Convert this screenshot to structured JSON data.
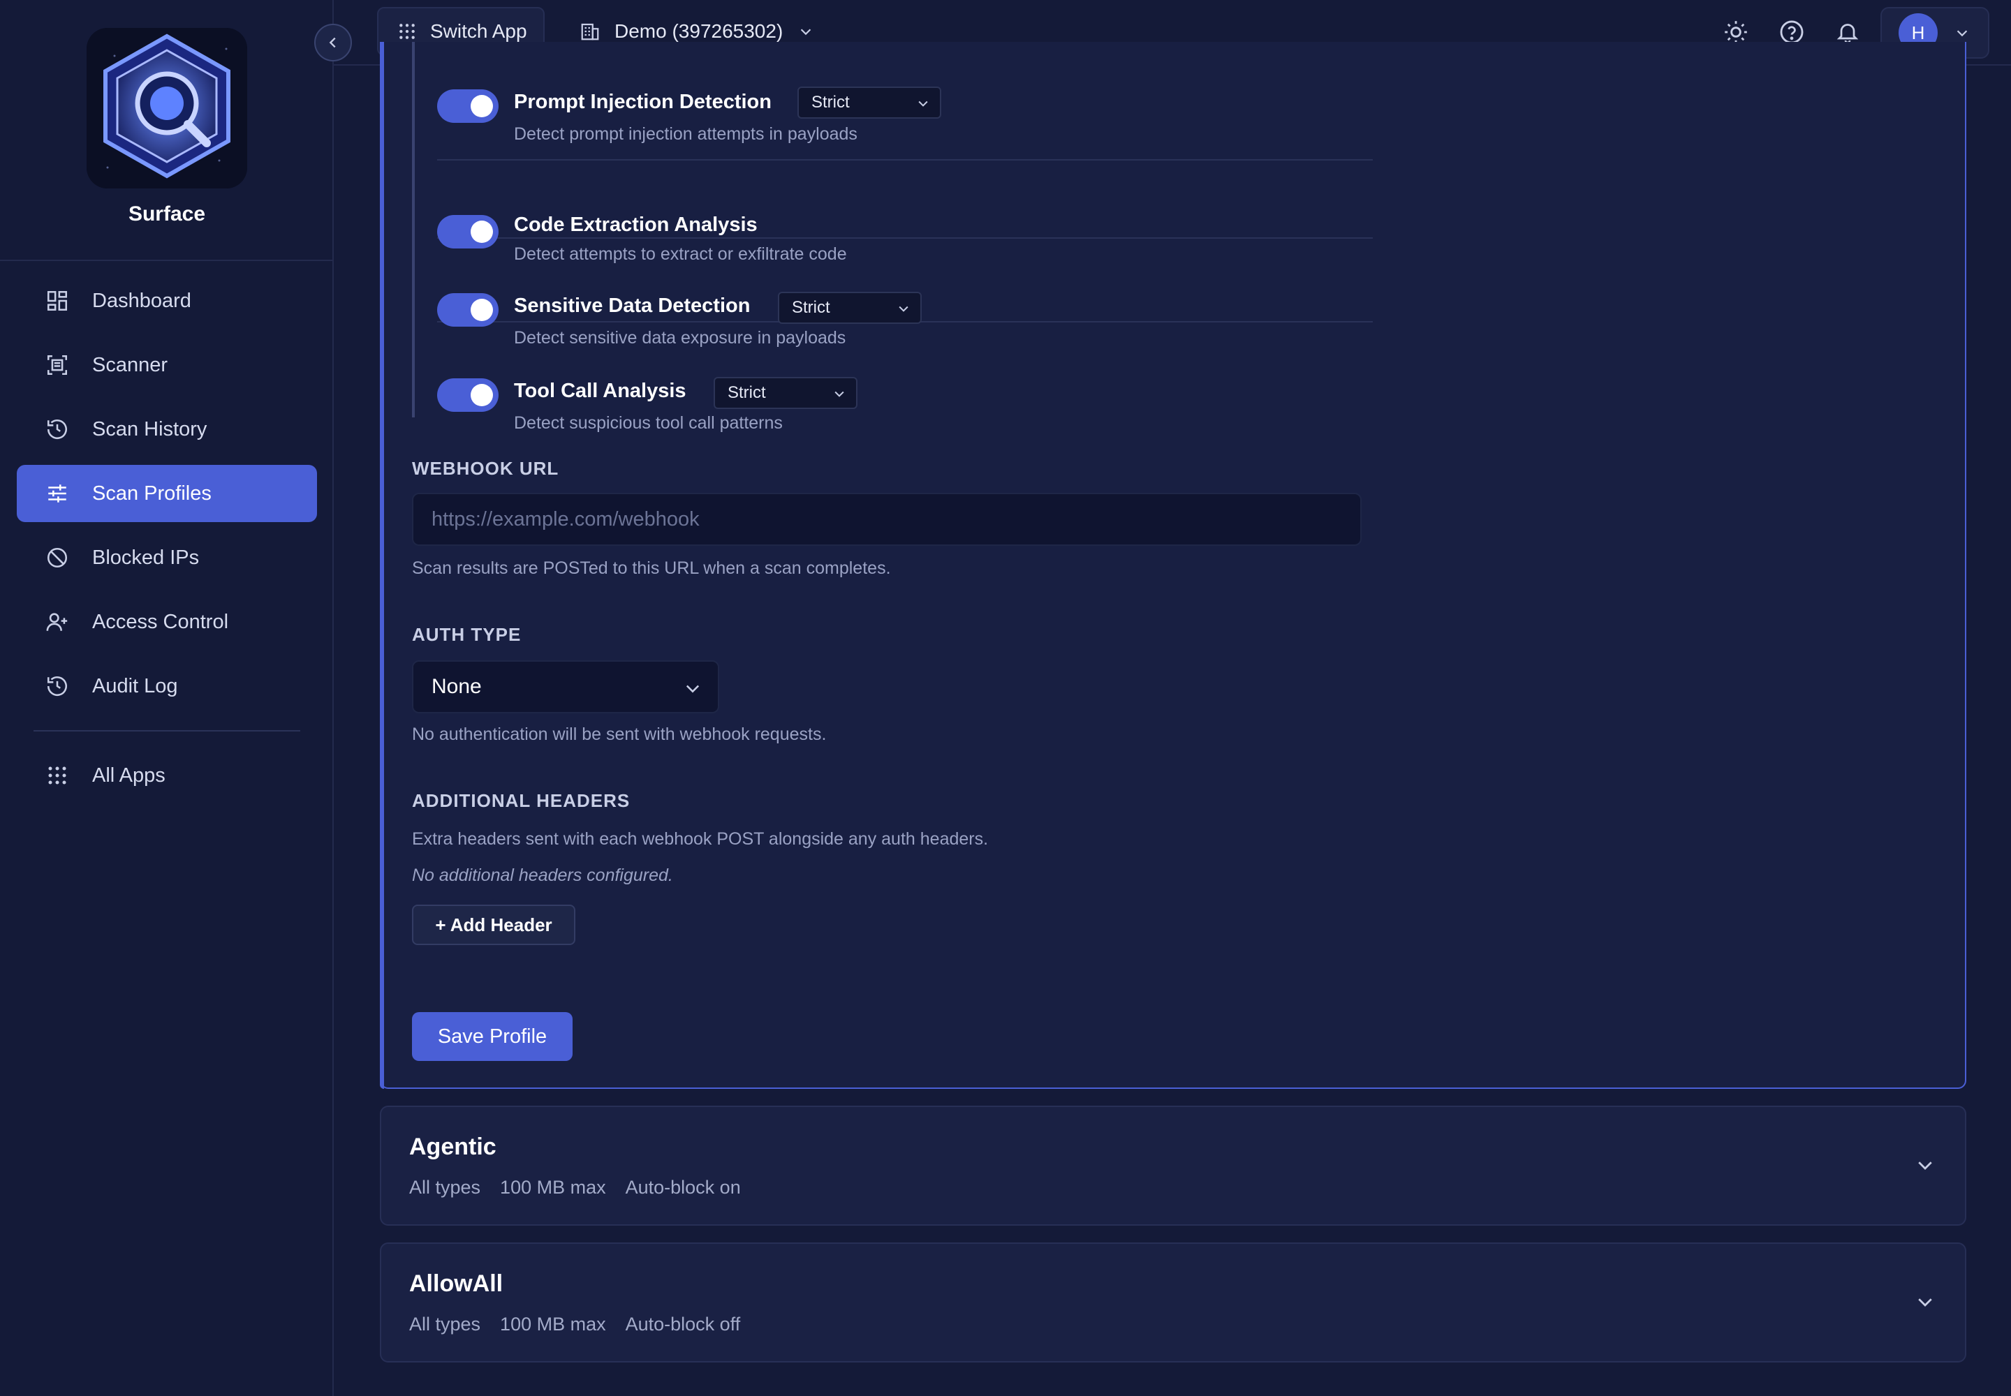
{
  "sidebar": {
    "brand_name": "Surface",
    "items": [
      {
        "label": "Dashboard",
        "icon": "dashboard-icon"
      },
      {
        "label": "Scanner",
        "icon": "scanner-icon"
      },
      {
        "label": "Scan History",
        "icon": "history-icon"
      },
      {
        "label": "Scan Profiles",
        "icon": "sliders-icon",
        "active": true
      },
      {
        "label": "Blocked IPs",
        "icon": "blocked-icon"
      },
      {
        "label": "Access Control",
        "icon": "user-plus-icon"
      },
      {
        "label": "Audit Log",
        "icon": "history-icon"
      }
    ],
    "all_apps_label": "All Apps"
  },
  "topbar": {
    "switch_app_label": "Switch App",
    "org_label": "Demo (397265302)",
    "avatar_initial": "H"
  },
  "checks": [
    {
      "title": "Prompt Injection Detection",
      "level": "Strict",
      "description": "Detect prompt injection attempts in payloads",
      "enabled": true
    },
    {
      "title": "Code Extraction Analysis",
      "level": "",
      "description": "Detect attempts to extract or exfiltrate code",
      "enabled": true
    },
    {
      "title": "Sensitive Data Detection",
      "level": "Strict",
      "description": "Detect sensitive data exposure in payloads",
      "enabled": true
    },
    {
      "title": "Tool Call Analysis",
      "level": "Strict",
      "description": "Detect suspicious tool call patterns",
      "enabled": true
    }
  ],
  "webhook": {
    "label": "WEBHOOK URL",
    "placeholder": "https://example.com/webhook",
    "value": "",
    "help": "Scan results are POSTed to this URL when a scan completes."
  },
  "auth": {
    "label": "AUTH TYPE",
    "value": "None",
    "help": "No authentication will be sent with webhook requests."
  },
  "headers": {
    "label": "ADDITIONAL HEADERS",
    "help": "Extra headers sent with each webhook POST alongside any auth headers.",
    "empty": "No additional headers configured.",
    "add_label": "+ Add Header"
  },
  "save_label": "Save Profile",
  "profiles": [
    {
      "name": "Agentic",
      "types": "All types",
      "max": "100 MB max",
      "auto_block": "Auto-block on"
    },
    {
      "name": "AllowAll",
      "types": "All types",
      "max": "100 MB max",
      "auto_block": "Auto-block off"
    }
  ],
  "colors": {
    "background": "#141a38",
    "accent": "#4a5fd6",
    "card": "#181f42",
    "muted_text": "#9aa2c4"
  }
}
